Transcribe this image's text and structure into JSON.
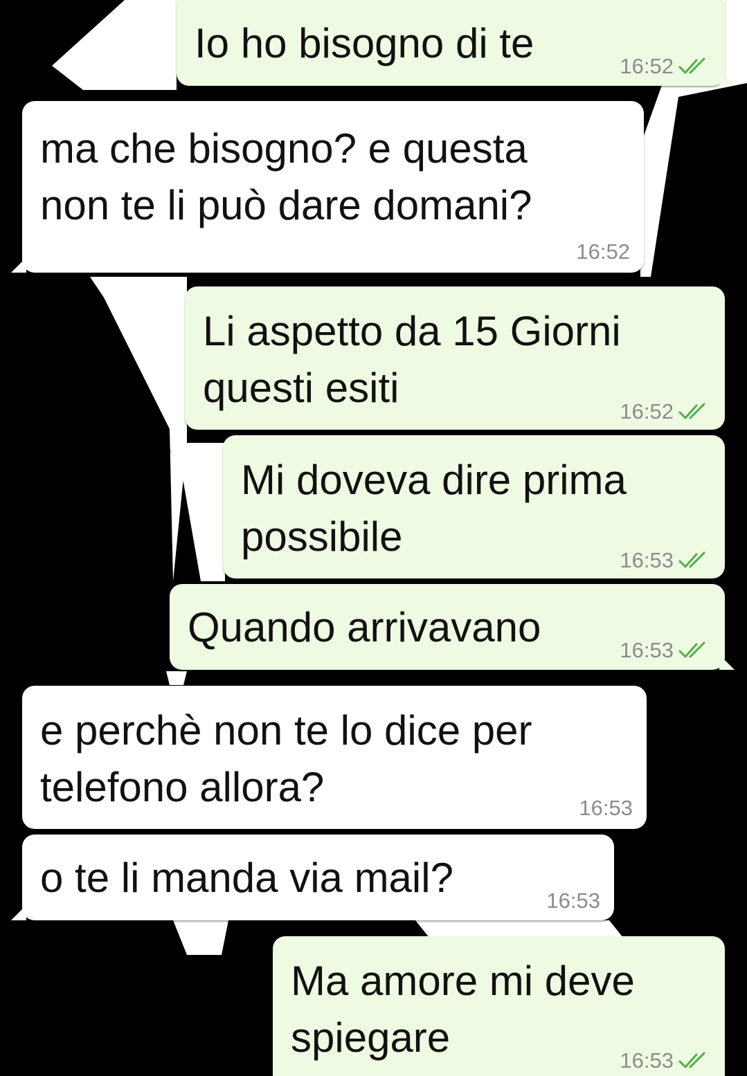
{
  "messages": [
    {
      "text": "Io ho bisogno di te",
      "time": "16:52",
      "direction": "out",
      "status": "read"
    },
    {
      "text": "ma che bisogno? e questa\nnon te li può dare domani?",
      "time": "16:52",
      "direction": "in"
    },
    {
      "text": "Li aspetto da 15 Giorni\nquesti esiti",
      "time": "16:52",
      "direction": "out",
      "status": "read"
    },
    {
      "text": "Mi doveva dire prima\npossibile",
      "time": "16:53",
      "direction": "out",
      "status": "read"
    },
    {
      "text": "Quando arrivavano",
      "time": "16:53",
      "direction": "out",
      "status": "read"
    },
    {
      "text": "e perchè non te lo dice per\ntelefono allora?",
      "time": "16:53",
      "direction": "in"
    },
    {
      "text": "o te li manda via mail?",
      "time": "16:53",
      "direction": "in"
    },
    {
      "text": "Ma amore mi deve\nspiegare",
      "time": "16:53",
      "direction": "out",
      "status": "read"
    }
  ],
  "colors": {
    "outgoing_bubble": "#eefbe2",
    "incoming_bubble": "#ffffff",
    "read_ticks": "#4fae4a",
    "timestamp": "#8c8c8c",
    "wallpaper_dark": "#000000",
    "wallpaper_light": "#ffffff"
  },
  "icons": {
    "read_status": "double-check-icon"
  }
}
